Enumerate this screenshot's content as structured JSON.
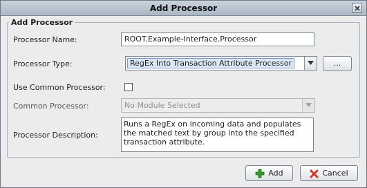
{
  "window": {
    "title": "Add Processor"
  },
  "group": {
    "title": "Add Processor"
  },
  "fields": {
    "name_label": "Processor Name:",
    "name_value": "ROOT.Example-Interface.Processor",
    "type_label": "Processor Type:",
    "type_value": "RegEx Into Transaction Attribute Processor",
    "browse_label": "...",
    "use_common_label": "Use Common Processor:",
    "use_common_checked": false,
    "common_label": "Common Processor:",
    "common_value": "No Module Selected",
    "description_label": "Processor Description:",
    "description_value": "Runs a RegEx on incoming data and populates the matched text by group into the specified transaction attribute."
  },
  "buttons": {
    "add_label": "Add",
    "cancel_label": "Cancel"
  },
  "colors": {
    "add_icon": "#3a9a2c",
    "cancel_icon": "#d23a2a",
    "selection": "#dce7f5"
  }
}
